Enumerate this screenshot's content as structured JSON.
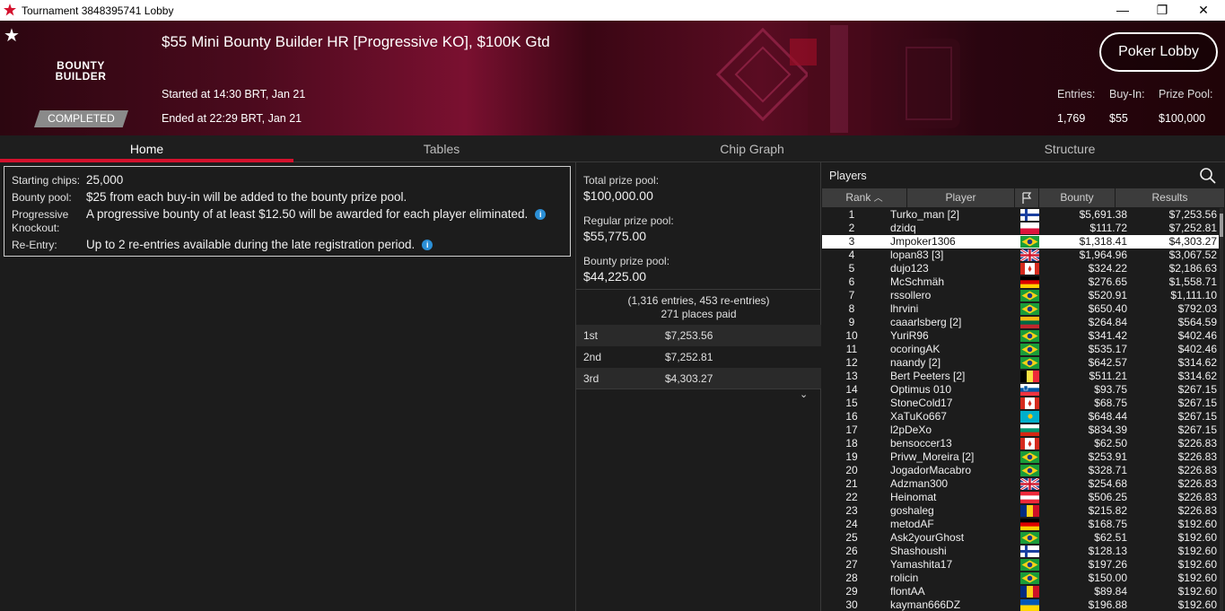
{
  "window": {
    "title": "Tournament 3848395741 Lobby",
    "minimize": "—",
    "maximize": "❐",
    "close": "✕"
  },
  "header": {
    "brand_line1": "BOUNTY",
    "brand_line2": "BUILDER",
    "status": "COMPLETED",
    "tournament_name": "$55 Mini Bounty Builder HR [Progressive KO], $100K Gtd",
    "started": "Started at 14:30 BRT, Jan 21",
    "ended": "Ended at 22:29 BRT, Jan 21",
    "lobby_button": "Poker Lobby",
    "entries_label": "Entries:",
    "entries_value": "1,769",
    "buyin_label": "Buy-In:",
    "buyin_value": "$55",
    "prizepool_label": "Prize Pool:",
    "prizepool_value": "$100,000"
  },
  "tabs": [
    "Home",
    "Tables",
    "Chip Graph",
    "Structure"
  ],
  "info": {
    "starting_chips_label": "Starting chips:",
    "starting_chips": "25,000",
    "bounty_pool_label": "Bounty pool:",
    "bounty_pool": "$25 from each buy-in will be added to the bounty prize pool.",
    "pko_label_1": "Progressive",
    "pko_label_2": "Knockout:",
    "pko": "A progressive bounty of at least $12.50 will be awarded for each player eliminated.",
    "reentry_label": "Re-Entry:",
    "reentry": "Up to 2 re-entries available during the late registration period."
  },
  "prizes": {
    "total_label": "Total prize pool:",
    "total": "$100,000.00",
    "regular_label": "Regular prize pool:",
    "regular": "$55,775.00",
    "bounty_label": "Bounty prize pool:",
    "bounty": "$44,225.00",
    "entries_note": "(1,316 entries, 453 re-entries)",
    "places_paid": "271 places paid",
    "places": [
      {
        "place": "1st",
        "amount": "$7,253.56"
      },
      {
        "place": "2nd",
        "amount": "$7,252.81"
      },
      {
        "place": "3rd",
        "amount": "$4,303.27"
      }
    ]
  },
  "players": {
    "title": "Players",
    "columns": {
      "rank": "Rank",
      "player": "Player",
      "bounty": "Bounty",
      "results": "Results"
    },
    "rows": [
      {
        "rank": "1",
        "name": "Turko_man [2]",
        "flag": "fi",
        "bounty": "$5,691.38",
        "result": "$7,253.56"
      },
      {
        "rank": "2",
        "name": "dzidq",
        "flag": "pl",
        "bounty": "$111.72",
        "result": "$7,252.81"
      },
      {
        "rank": "3",
        "name": "Jmpoker1306",
        "flag": "br",
        "bounty": "$1,318.41",
        "result": "$4,303.27",
        "selected": true
      },
      {
        "rank": "4",
        "name": "lopan83 [3]",
        "flag": "gb",
        "bounty": "$1,964.96",
        "result": "$3,067.52"
      },
      {
        "rank": "5",
        "name": "dujo123",
        "flag": "ca",
        "bounty": "$324.22",
        "result": "$2,186.63"
      },
      {
        "rank": "6",
        "name": "McSchmäh",
        "flag": "de",
        "bounty": "$276.65",
        "result": "$1,558.71"
      },
      {
        "rank": "7",
        "name": "rssollero",
        "flag": "br",
        "bounty": "$520.91",
        "result": "$1,111.10"
      },
      {
        "rank": "8",
        "name": "lhrvini",
        "flag": "br",
        "bounty": "$650.40",
        "result": "$792.03"
      },
      {
        "rank": "9",
        "name": "caaarlsberg [2]",
        "flag": "lt",
        "bounty": "$264.84",
        "result": "$564.59"
      },
      {
        "rank": "10",
        "name": "YuriR96",
        "flag": "br",
        "bounty": "$341.42",
        "result": "$402.46"
      },
      {
        "rank": "11",
        "name": "ocoringAK",
        "flag": "br",
        "bounty": "$535.17",
        "result": "$402.46"
      },
      {
        "rank": "12",
        "name": "naandy [2]",
        "flag": "br",
        "bounty": "$642.57",
        "result": "$314.62"
      },
      {
        "rank": "13",
        "name": "Bert Peeters [2]",
        "flag": "be",
        "bounty": "$511.21",
        "result": "$314.62"
      },
      {
        "rank": "14",
        "name": "Optimus 010",
        "flag": "si",
        "bounty": "$93.75",
        "result": "$267.15"
      },
      {
        "rank": "15",
        "name": "StoneCold17",
        "flag": "ca",
        "bounty": "$68.75",
        "result": "$267.15"
      },
      {
        "rank": "16",
        "name": "XaTuKo667",
        "flag": "kz",
        "bounty": "$648.44",
        "result": "$267.15"
      },
      {
        "rank": "17",
        "name": "l2pDeXo",
        "flag": "bg",
        "bounty": "$834.39",
        "result": "$267.15"
      },
      {
        "rank": "18",
        "name": "bensoccer13",
        "flag": "ca",
        "bounty": "$62.50",
        "result": "$226.83"
      },
      {
        "rank": "19",
        "name": "Privw_Moreira [2]",
        "flag": "br",
        "bounty": "$253.91",
        "result": "$226.83"
      },
      {
        "rank": "20",
        "name": "JogadorMacabro",
        "flag": "br",
        "bounty": "$328.71",
        "result": "$226.83"
      },
      {
        "rank": "21",
        "name": "Adzman300",
        "flag": "gb",
        "bounty": "$254.68",
        "result": "$226.83"
      },
      {
        "rank": "22",
        "name": "Heinomat",
        "flag": "at",
        "bounty": "$506.25",
        "result": "$226.83"
      },
      {
        "rank": "23",
        "name": "goshaleg",
        "flag": "ro",
        "bounty": "$215.82",
        "result": "$226.83"
      },
      {
        "rank": "24",
        "name": "metodAF",
        "flag": "de",
        "bounty": "$168.75",
        "result": "$192.60"
      },
      {
        "rank": "25",
        "name": "Ask2yourGhost",
        "flag": "br",
        "bounty": "$62.51",
        "result": "$192.60"
      },
      {
        "rank": "26",
        "name": "Shashoushi",
        "flag": "fi",
        "bounty": "$128.13",
        "result": "$192.60"
      },
      {
        "rank": "27",
        "name": "Yamashita17",
        "flag": "br",
        "bounty": "$197.26",
        "result": "$192.60"
      },
      {
        "rank": "28",
        "name": "rolicin",
        "flag": "br",
        "bounty": "$150.00",
        "result": "$192.60"
      },
      {
        "rank": "29",
        "name": "flontAA",
        "flag": "ro",
        "bounty": "$89.84",
        "result": "$192.60"
      },
      {
        "rank": "30",
        "name": "kayman666DZ",
        "flag": "ua",
        "bounty": "$196.88",
        "result": "$192.60"
      }
    ]
  },
  "colors": {
    "accent": "#d4112d",
    "completed": "#8a8a8a",
    "header_dark": "#2c0610",
    "selected_row": "#ffffff"
  }
}
